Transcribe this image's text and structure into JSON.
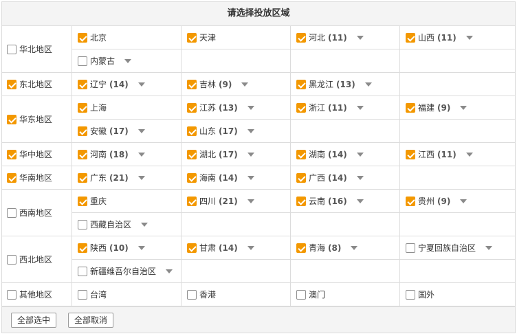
{
  "title": "请选择投放区域",
  "regions": [
    {
      "name": "华北地区",
      "checked": false,
      "rows": [
        [
          {
            "name": "北京",
            "checked": true
          },
          {
            "name": "天津",
            "checked": true
          },
          {
            "name": "河北",
            "count": "(11)",
            "checked": true
          },
          {
            "name": "山西",
            "count": "(11)",
            "checked": true
          }
        ],
        [
          {
            "name": "内蒙古",
            "checked": false,
            "dropdown": true
          }
        ]
      ]
    },
    {
      "name": "东北地区",
      "checked": true,
      "rows": [
        [
          {
            "name": "辽宁",
            "count": "(14)",
            "checked": true
          },
          {
            "name": "吉林",
            "count": "(9)",
            "checked": true
          },
          {
            "name": "黑龙江",
            "count": "(13)",
            "checked": true
          }
        ]
      ]
    },
    {
      "name": "华东地区",
      "checked": true,
      "rows": [
        [
          {
            "name": "上海",
            "checked": true
          },
          {
            "name": "江苏",
            "count": "(13)",
            "checked": true
          },
          {
            "name": "浙江",
            "count": "(11)",
            "checked": true
          },
          {
            "name": "福建",
            "count": "(9)",
            "checked": true
          }
        ],
        [
          {
            "name": "安徽",
            "count": "(17)",
            "checked": true
          },
          {
            "name": "山东",
            "count": "(17)",
            "checked": true
          }
        ]
      ]
    },
    {
      "name": "华中地区",
      "checked": true,
      "rows": [
        [
          {
            "name": "河南",
            "count": "(18)",
            "checked": true
          },
          {
            "name": "湖北",
            "count": "(17)",
            "checked": true
          },
          {
            "name": "湖南",
            "count": "(14)",
            "checked": true
          },
          {
            "name": "江西",
            "count": "(11)",
            "checked": true
          }
        ]
      ]
    },
    {
      "name": "华南地区",
      "checked": true,
      "rows": [
        [
          {
            "name": "广东",
            "count": "(21)",
            "checked": true
          },
          {
            "name": "海南",
            "count": "(14)",
            "checked": true
          },
          {
            "name": "广西",
            "count": "(14)",
            "checked": true
          }
        ]
      ]
    },
    {
      "name": "西南地区",
      "checked": false,
      "rows": [
        [
          {
            "name": "重庆",
            "checked": true
          },
          {
            "name": "四川",
            "count": "(21)",
            "checked": true
          },
          {
            "name": "云南",
            "count": "(16)",
            "checked": true
          },
          {
            "name": "贵州",
            "count": "(9)",
            "checked": true
          }
        ],
        [
          {
            "name": "西藏自治区",
            "checked": false,
            "dropdown": true
          }
        ]
      ]
    },
    {
      "name": "西北地区",
      "checked": false,
      "rows": [
        [
          {
            "name": "陕西",
            "count": "(10)",
            "checked": true
          },
          {
            "name": "甘肃",
            "count": "(14)",
            "checked": true
          },
          {
            "name": "青海",
            "count": "(8)",
            "checked": true
          },
          {
            "name": "宁夏回族自治区",
            "checked": false,
            "dropdown": true
          }
        ],
        [
          {
            "name": "新疆维吾尔自治区",
            "checked": false,
            "dropdown": true
          }
        ]
      ]
    },
    {
      "name": "其他地区",
      "checked": false,
      "rows": [
        [
          {
            "name": "台湾",
            "checked": false
          },
          {
            "name": "香港",
            "checked": false
          },
          {
            "name": "澳门",
            "checked": false
          },
          {
            "name": "国外",
            "checked": false
          }
        ]
      ]
    }
  ],
  "buttons": {
    "select_all": "全部选中",
    "deselect_all": "全部取消"
  },
  "colors": {
    "checked": "#f39800",
    "border": "#dcdcdc",
    "header_bg": "#f4f4f4"
  },
  "icons": {
    "checked": "checkbox-checked-icon",
    "unchecked": "checkbox-unchecked-icon",
    "dropdown": "dropdown-arrow-icon"
  }
}
